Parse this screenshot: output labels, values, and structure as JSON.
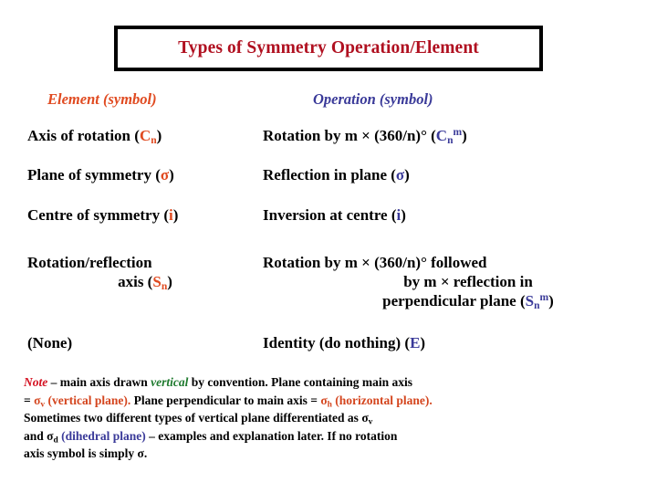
{
  "slide": {
    "title": "Types of Symmetry Operation/Element",
    "title_color": "#B01020",
    "border_color": "#000000"
  },
  "columns": {
    "element_header": "Element (symbol)",
    "element_header_color": "#E04A20",
    "operation_header": "Operation (symbol)",
    "operation_header_color": "#3A3A99"
  },
  "rows": [
    {
      "element_text": "Axis of rotation (",
      "element_symbol": "C",
      "element_symbol_sub": "n",
      "element_symbol_sup": "",
      "element_tail": ")",
      "operation_line1_pre": "Rotation by m × (360/n)°  (",
      "operation_symbol": "C",
      "operation_symbol_sub": "n",
      "operation_symbol_sup": "m",
      "operation_tail": ")"
    },
    {
      "element_text": "Plane of symmetry (",
      "element_symbol": "σ",
      "element_symbol_sub": "",
      "element_symbol_sup": "",
      "element_tail": ")",
      "operation_line1_pre": "Reflection in plane (",
      "operation_symbol": "σ",
      "operation_symbol_sub": "",
      "operation_symbol_sup": "",
      "operation_tail": ")"
    },
    {
      "element_text": "Centre of symmetry (",
      "element_symbol": "i",
      "element_symbol_sub": "",
      "element_symbol_sup": "",
      "element_tail": ")",
      "operation_line1_pre": "Inversion at centre (",
      "operation_symbol": "i",
      "operation_symbol_sub": "",
      "operation_symbol_sup": "",
      "operation_tail": ")"
    },
    {
      "element_line1": "Rotation/reflection",
      "element_line2_pre": "axis (",
      "element_symbol": "S",
      "element_symbol_sub": "n",
      "element_tail": ")",
      "operation_line1": "Rotation by m × (360/n)° followed",
      "operation_line2": "by m × reflection in",
      "operation_line3_pre": "perpendicular plane (",
      "operation_symbol": "S",
      "operation_symbol_sub": "n",
      "operation_symbol_sup": "m",
      "operation_tail": ")"
    },
    {
      "element_text": "(None)",
      "operation_line1_pre": "Identity (do nothing) (",
      "operation_symbol": "E",
      "operation_symbol_sub": "",
      "operation_symbol_sup": "",
      "operation_tail": ")"
    }
  ],
  "note": {
    "label": "Note",
    "label_color": "#D41020",
    "line1_a": " – main axis drawn ",
    "line1_emph": "vertical",
    "line1_emph_color": "#1E7A2E",
    "line1_b": " by convention.  Plane containing main axis",
    "line2_a": "= ",
    "line2_sigma_v": "σ",
    "line2_sigma_v_sub": "v",
    "line2_b": " (vertical plane).",
    "line2_c": "  Plane perpendicular to main axis = ",
    "line2_sigma_h": "σ",
    "line2_sigma_h_sub": "h",
    "line2_d": " (horizontal plane).",
    "line3_a": "Sometimes two different types of vertical plane differentiated as ",
    "line3_sigma_v": "σ",
    "line3_sigma_v_sub": "v",
    "line4_a": "and ",
    "line4_sigma_d": "σ",
    "line4_sigma_d_sub": "d",
    "line4_b": " (dihedral plane)",
    "line4_b_color": "#3A3A99",
    "line4_c": " – examples and explanation later.  If no rotation",
    "line5_a": "axis symbol is simply ",
    "line5_sigma": "σ",
    "line5_b": "."
  }
}
